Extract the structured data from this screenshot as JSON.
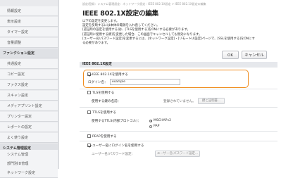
{
  "sidebar": {
    "items": [
      {
        "label": "情報設定",
        "type": "item"
      },
      {
        "label": "表示設定",
        "type": "item"
      },
      {
        "label": "タイマー設定",
        "type": "item"
      },
      {
        "label": "音量調整",
        "type": "item"
      },
      {
        "label": "ファンクション設定",
        "type": "header"
      },
      {
        "label": "共通設定",
        "type": "item"
      },
      {
        "label": "コピー設定",
        "type": "item"
      },
      {
        "label": "ファクス設定",
        "type": "item"
      },
      {
        "label": "スキャン設定",
        "type": "item"
      },
      {
        "label": "メディアプリント設定",
        "type": "item"
      },
      {
        "label": "プリンター設定",
        "type": "item"
      },
      {
        "label": "レポートの設定",
        "type": "item"
      },
      {
        "label": "よく使う設定",
        "type": "item"
      },
      {
        "label": "システム管理設定",
        "type": "header"
      },
      {
        "label": "システム管理",
        "type": "item"
      },
      {
        "label": "部門別ID管理",
        "type": "item"
      },
      {
        "label": "ネットワーク設定",
        "type": "item"
      }
    ]
  },
  "header": {
    "breadcrumb": "設定/登録：システム管理設定：ネットワーク設定：IEEE 802.1X設定 > IEEE 802.1X設定の編集",
    "title": "IEEE 802.1X設定の編集"
  },
  "description": [
    "以下の設定を変更します。",
    "設定を反映するには本体の電源を入れ直してください。",
    "[認証時の設定を使用する]は、[TLSを使用する]をONにする必要があります。",
    "[認証時に使用する鍵]を変更した場合、この画面でキャンセルしても無効になります。",
    "[ユーザー名/パスワード設定]を変更するには、[ネットワーク設定]・[リモートUI設定]ページで、[SSLを使用する]をONにする必要があります。"
  ],
  "buttons": {
    "ok": "OK",
    "cancel": "キャンセル"
  },
  "section": {
    "title": "IEEE 802.1X設定"
  },
  "ieee": {
    "use_label": "IEEE 802.1Xを使用する",
    "checked": true
  },
  "login": {
    "label": "ログイン名：",
    "value": "example"
  },
  "tls": {
    "use_label": "TLSを使用する",
    "checked": false,
    "key_label": "使用する鍵の名前：",
    "key_status": "登録されていません。",
    "key_button": "鍵と証明書..."
  },
  "ttls": {
    "use_label": "TTLSを使用する",
    "checked": false,
    "protocol_label": "使用するTTLS(内部プロトコル)：",
    "options": [
      "MSCHAPv2",
      "PAP"
    ],
    "selected": "MSCHAPv2"
  },
  "peap": {
    "use_label": "PEAPを使用する",
    "checked": false
  },
  "user_as_login": {
    "label": "ユーザー名にログイン名を使用する",
    "checked": true
  },
  "userpass": {
    "label": "ユーザー名/パスワード設定：",
    "button": "ユーザー名/パスワード設定..."
  }
}
